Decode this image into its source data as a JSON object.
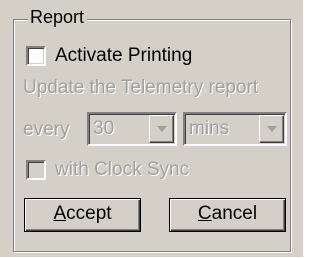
{
  "group": {
    "title": "Report"
  },
  "activate_printing": {
    "label": "Activate Printing",
    "checked": false
  },
  "update_text": "Update the Telemetry report",
  "every_label": "every",
  "interval": {
    "value": "30",
    "icon": "chevron-down-icon"
  },
  "unit": {
    "value": "mins",
    "icon": "chevron-down-icon"
  },
  "clock_sync": {
    "label": "with Clock Sync",
    "checked": false,
    "enabled": false
  },
  "buttons": {
    "accept": {
      "mnemonic": "A",
      "rest": "ccept"
    },
    "cancel": {
      "mnemonic": "C",
      "rest": "ancel"
    }
  },
  "colors": {
    "face": "#d4d0c8",
    "disabled_text": "#a0a0a0",
    "shadow": "#808080",
    "highlight": "#ffffff"
  }
}
